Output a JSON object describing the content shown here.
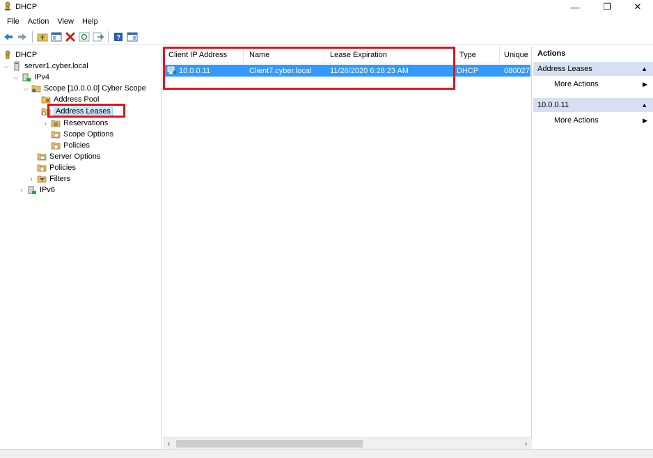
{
  "window": {
    "title": "DHCP",
    "minimize_glyph": "—",
    "maximize_glyph": "❐",
    "close_glyph": "✕"
  },
  "menu": [
    "File",
    "Action",
    "View",
    "Help"
  ],
  "toolbar": {
    "icons": [
      "back-arrow-icon",
      "forward-arrow-icon",
      "up-folder-icon",
      "show-hide-tree-icon",
      "delete-icon",
      "refresh-icon",
      "export-list-icon",
      "help-icon",
      "show-hide-action-pane-icon"
    ]
  },
  "tree": {
    "root": "DHCP",
    "server": "server1.cyber.local",
    "ipv4": "IPv4",
    "scope": "Scope [10.0.0.0] Cyber Scope",
    "address_pool": "Address Pool",
    "address_leases": "Address Leases",
    "reservations": "Reservations",
    "scope_options": "Scope Options",
    "scope_policies": "Policies",
    "server_options": "Server Options",
    "policies": "Policies",
    "filters": "Filters",
    "ipv6": "IPv6"
  },
  "list": {
    "columns": [
      "Client IP Address",
      "Name",
      "Lease Expiration",
      "Type",
      "Unique"
    ],
    "rows": [
      {
        "ip": "10.0.0.11",
        "name": "Client7.cyber.local",
        "expiration": "11/26/2020 6:28:23 AM",
        "type": "DHCP",
        "unique": "080027"
      }
    ]
  },
  "actions": {
    "title": "Actions",
    "sections": [
      {
        "label": "Address Leases",
        "item": "More Actions"
      },
      {
        "label": "10.0.0.11",
        "item": "More Actions"
      }
    ]
  },
  "colors": {
    "selection": "#3399ff",
    "tree_selection": "#cce8ff",
    "highlight_box": "#e0141e",
    "action_section": "#d5e1f2"
  }
}
